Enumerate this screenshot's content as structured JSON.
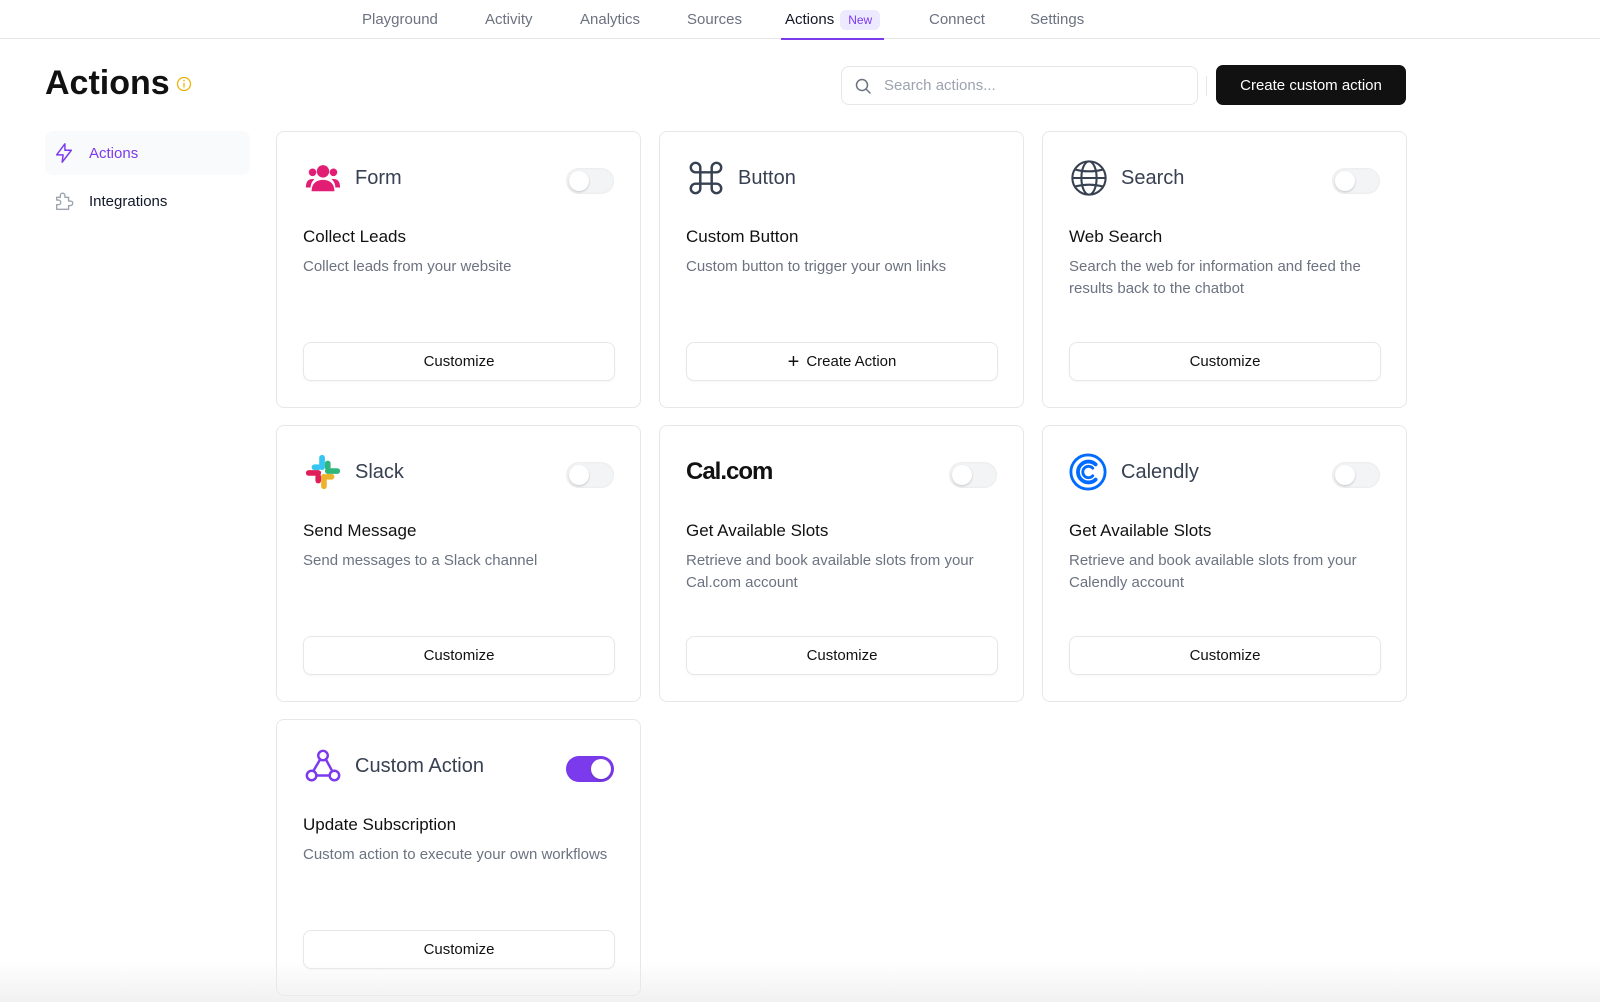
{
  "nav": {
    "tabs": [
      {
        "label": "Playground"
      },
      {
        "label": "Activity"
      },
      {
        "label": "Analytics"
      },
      {
        "label": "Sources"
      },
      {
        "label": "Actions",
        "badge": "New"
      },
      {
        "label": "Connect"
      },
      {
        "label": "Settings"
      }
    ],
    "active": "Actions"
  },
  "header": {
    "title": "Actions",
    "search_placeholder": "Search actions...",
    "create_label": "Create custom action"
  },
  "sidebar": {
    "items": [
      {
        "label": "Actions",
        "icon": "lightning-icon"
      },
      {
        "label": "Integrations",
        "icon": "puzzle-icon"
      }
    ]
  },
  "cards": [
    {
      "name": "Form",
      "icon": "users-icon",
      "title": "Collect Leads",
      "description": "Collect leads from your website",
      "button": "Customize",
      "enabled": false
    },
    {
      "name": "Button",
      "icon": "command-icon",
      "title": "Custom Button",
      "description": "Custom button to trigger your own links",
      "button": "Create Action",
      "enabled": null
    },
    {
      "name": "Search",
      "icon": "globe-icon",
      "title": "Web Search",
      "description": "Search the web for information and feed the results back to the chatbot",
      "button": "Customize",
      "enabled": false
    },
    {
      "name": "Slack",
      "icon": "slack-icon",
      "title": "Send Message",
      "description": "Send messages to a Slack channel",
      "button": "Customize",
      "enabled": false
    },
    {
      "name": "Cal.com",
      "icon": "calcom-logo",
      "title": "Get Available Slots",
      "description": "Retrieve and book available slots from your Cal.com account",
      "button": "Customize",
      "enabled": false
    },
    {
      "name": "Calendly",
      "icon": "calendly-icon",
      "title": "Get Available Slots",
      "description": "Retrieve and book available slots from your Calendly account",
      "button": "Customize",
      "enabled": false
    },
    {
      "name": "Custom Action",
      "icon": "webhook-icon",
      "title": "Update Subscription",
      "description": "Custom action to execute your own workflows",
      "button": "Customize",
      "enabled": true
    }
  ],
  "colors": {
    "accent": "#7c3aed",
    "form_icon": "#e11d74",
    "calendly": "#006bff",
    "info": "#eab308"
  }
}
